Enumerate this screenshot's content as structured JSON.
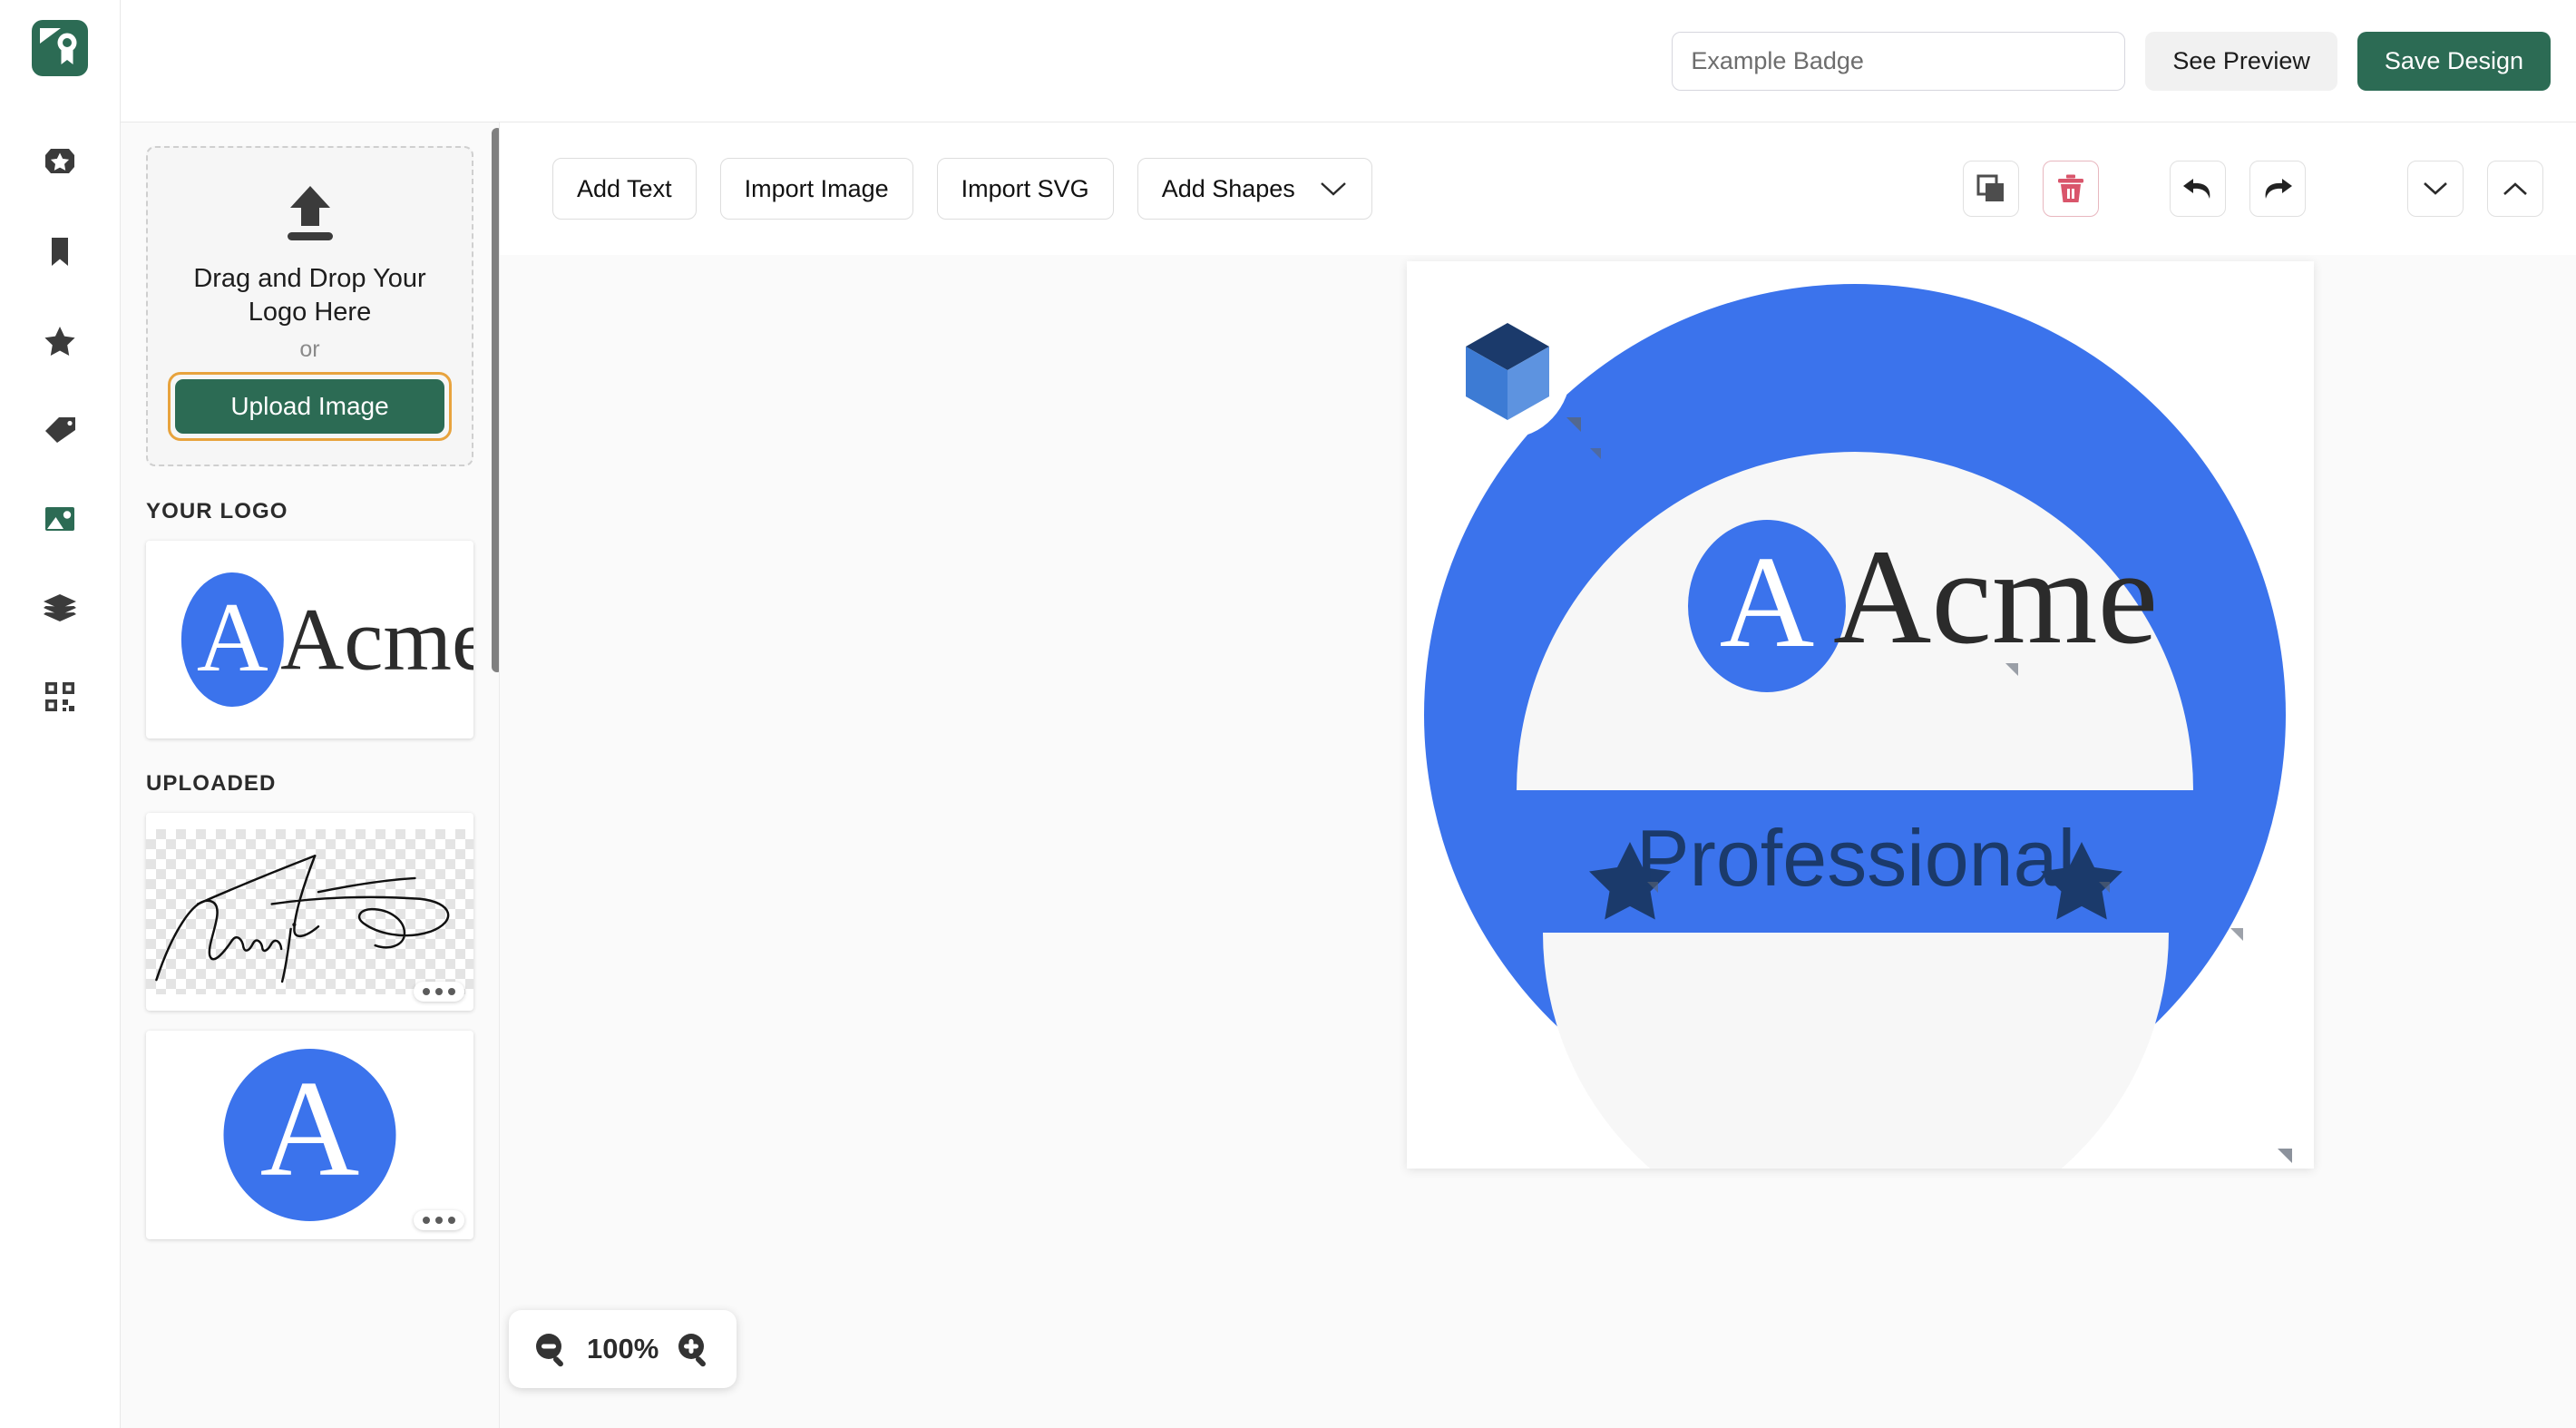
{
  "app": {
    "brand_color": "#2c6b54",
    "accent_orange": "#e8a33d",
    "danger_color": "#d9556b",
    "badge_blue": "#3b73ec",
    "badge_navy": "#1b3a6b"
  },
  "rail": {
    "logo_icon": "certificate-badge-icon",
    "items": [
      {
        "icon": "badge-star-icon",
        "name": "badge-shapes",
        "active": false
      },
      {
        "icon": "bookmark-icon",
        "name": "ribbons",
        "active": false
      },
      {
        "icon": "star-icon",
        "name": "stars",
        "active": false
      },
      {
        "icon": "tag-icon",
        "name": "tags",
        "active": false
      },
      {
        "icon": "image-icon",
        "name": "images",
        "active": true
      },
      {
        "icon": "layers-icon",
        "name": "layers",
        "active": false
      },
      {
        "icon": "qr-code-icon",
        "name": "qr-code",
        "active": false
      }
    ]
  },
  "header": {
    "badge_name_value": "",
    "badge_name_placeholder": "Example Badge",
    "preview_label": "See Preview",
    "save_label": "Save Design"
  },
  "panel": {
    "dropzone": {
      "icon": "upload-icon",
      "line1": "Drag and Drop Your",
      "line2": "Logo Here",
      "or_label": "or",
      "upload_label": "Upload Image"
    },
    "your_logo_title": "YOUR LOGO",
    "uploaded_title": "UPLOADED",
    "your_logo_items": [
      {
        "name": "acme-wordmark-logo",
        "kind": "acme-logo",
        "menu": false
      }
    ],
    "uploaded_items": [
      {
        "name": "signature-image",
        "kind": "signature",
        "transparent": true,
        "menu": true,
        "menu_icon": "more-options-icon"
      },
      {
        "name": "acme-monogram-image",
        "kind": "monogram",
        "transparent": false,
        "menu": true,
        "menu_icon": "more-options-icon"
      }
    ]
  },
  "toolbar": {
    "buttons": [
      {
        "label": "Add Text",
        "name": "add-text-button",
        "caret": false
      },
      {
        "label": "Import Image",
        "name": "import-image-button",
        "caret": false
      },
      {
        "label": "Import SVG",
        "name": "import-svg-button",
        "caret": false
      },
      {
        "label": "Add Shapes",
        "name": "add-shapes-button",
        "caret": true
      }
    ],
    "actions": [
      {
        "icon": "duplicate-icon",
        "name": "duplicate-button"
      },
      {
        "icon": "trash-icon",
        "name": "delete-button"
      },
      {
        "icon": "undo-icon",
        "name": "undo-button"
      },
      {
        "icon": "redo-icon",
        "name": "redo-button"
      },
      {
        "icon": "chevron-down-icon",
        "name": "send-backward-button"
      },
      {
        "icon": "chevron-up-icon",
        "name": "bring-forward-button"
      }
    ]
  },
  "canvas": {
    "badge": {
      "ring_color": "#3b73ec",
      "inner_fill": "#f7f7f7",
      "logo_text": "Acme",
      "logo_monogram": "A",
      "tier_text": "Professional",
      "tier_color": "#1b3a6b",
      "star_left": "star-icon",
      "star_right": "star-icon",
      "cube_icon": "cube-icon"
    }
  },
  "zoom": {
    "zoom_out_icon": "zoom-out-icon",
    "level": "100%",
    "zoom_in_icon": "zoom-in-icon"
  }
}
